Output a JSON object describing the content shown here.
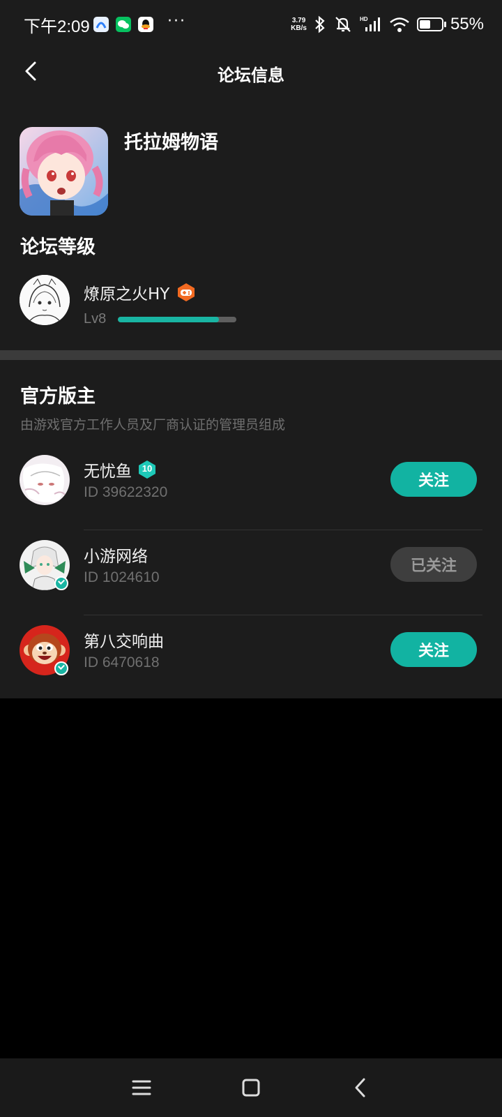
{
  "status_bar": {
    "time": "下午2:09",
    "net_speed_value": "3.79",
    "net_speed_unit": "KB/s",
    "battery_percent": 55,
    "battery_text": "55%",
    "dots": "···"
  },
  "header": {
    "title": "论坛信息"
  },
  "forum": {
    "name": "托拉姆物语",
    "level_heading": "论坛等级",
    "user": {
      "name": "燎原之火HY",
      "level": "Lv8",
      "level_progress": 0.85
    }
  },
  "moderators": {
    "heading": "官方版主",
    "subtitle": "由游戏官方工作人员及厂商认证的管理员组成",
    "items": [
      {
        "name": "无忧鱼",
        "id": "ID 39622320",
        "badge": "10",
        "button": "关注",
        "followed": false
      },
      {
        "name": "小游网络",
        "id": "ID 1024610",
        "button": "已关注",
        "followed": true
      },
      {
        "name": "第八交响曲",
        "id": "ID 6470618",
        "button": "关注",
        "followed": false
      }
    ]
  },
  "colors": {
    "accent": "#12b3a2",
    "surface": "#1c1c1c",
    "background": "#000000"
  }
}
